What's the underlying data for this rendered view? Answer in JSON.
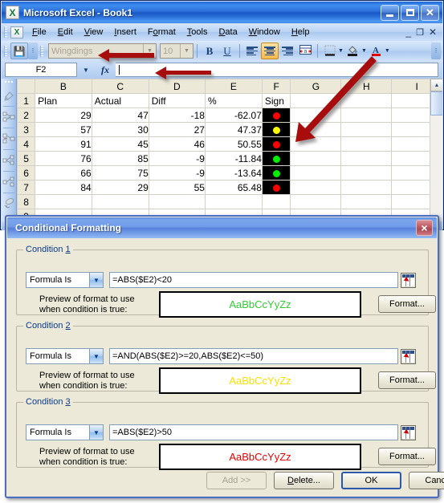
{
  "excel": {
    "title": "Microsoft Excel - Book1",
    "window_buttons": {
      "minimize": "minimize-icon",
      "restore": "restore-icon",
      "close": "close-icon"
    },
    "menus": [
      {
        "label": "File",
        "accel": "F"
      },
      {
        "label": "Edit",
        "accel": "E"
      },
      {
        "label": "View",
        "accel": "V"
      },
      {
        "label": "Insert",
        "accel": "I"
      },
      {
        "label": "Format",
        "accel": "o"
      },
      {
        "label": "Tools",
        "accel": "T"
      },
      {
        "label": "Data",
        "accel": "D"
      },
      {
        "label": "Window",
        "accel": "W"
      },
      {
        "label": "Help",
        "accel": "H"
      }
    ],
    "doc_buttons": {
      "minimize": "_",
      "restore": "restore-doc-icon",
      "close": "×"
    },
    "toolbar": {
      "font_name": "Wingdings",
      "font_size": "10",
      "bold": "B",
      "underline": "U",
      "align_left": "align-left-icon",
      "align_center": "align-center-icon",
      "align_right": "align-right-icon",
      "merge_center": "merge-and-center-icon",
      "borders": "borders-icon",
      "fill_color": "fill-color-icon",
      "font_color": "font-color-icon"
    },
    "formula_bar": {
      "name_box": "F2",
      "fx_label": "fx",
      "value": ""
    },
    "sheet": {
      "columns": [
        "B",
        "C",
        "D",
        "E",
        "F",
        "G",
        "H",
        "I"
      ],
      "rows": [
        "1",
        "2",
        "3",
        "4",
        "5",
        "6",
        "7",
        "8",
        "9"
      ],
      "data": [
        {
          "row": "1",
          "B": "Plan",
          "C": "Actual",
          "D": "Diff",
          "E": "%",
          "F": "Sign",
          "text_row": true
        },
        {
          "row": "2",
          "B": "29",
          "C": "47",
          "D": "-18",
          "E": "-62.07",
          "sign": "#ff0000"
        },
        {
          "row": "3",
          "B": "57",
          "C": "30",
          "D": "27",
          "E": "47.37",
          "sign": "#ffff00"
        },
        {
          "row": "4",
          "B": "91",
          "C": "45",
          "D": "46",
          "E": "50.55",
          "sign": "#ff0000"
        },
        {
          "row": "5",
          "B": "76",
          "C": "85",
          "D": "-9",
          "E": "-11.84",
          "sign": "#00ee00"
        },
        {
          "row": "6",
          "B": "66",
          "C": "75",
          "D": "-9",
          "E": "-13.64",
          "sign": "#00ee00"
        },
        {
          "row": "7",
          "B": "84",
          "C": "29",
          "D": "55",
          "E": "65.48",
          "sign": "#ff0000"
        },
        {
          "row": "8",
          "B": "",
          "C": "",
          "D": "",
          "E": "",
          "sign": ""
        },
        {
          "row": "9",
          "B": "",
          "C": "",
          "D": "",
          "E": "",
          "sign": ""
        }
      ]
    }
  },
  "dialog": {
    "title": "Conditional Formatting",
    "close_label": "×",
    "preview_label_line1": "Preview of format to use",
    "preview_label_line2": "when condition is true:",
    "preview_sample": "AaBbCcYyZz",
    "format_button": "Format...",
    "conditions": [
      {
        "legend": "Condition 1",
        "legend_num": "1",
        "type": "Formula Is",
        "formula": "=ABS($E2)<20",
        "preview_color": "#33cc33"
      },
      {
        "legend": "Condition 2",
        "legend_num": "2",
        "type": "Formula Is",
        "formula": "=AND(ABS($E2)>=20,ABS($E2)<=50)",
        "preview_color": "#ffe000"
      },
      {
        "legend": "Condition 3",
        "legend_num": "3",
        "type": "Formula Is",
        "formula": "=ABS($E2)>50",
        "preview_color": "#ee0000"
      }
    ],
    "buttons": {
      "add": "Add >>",
      "delete": "Delete...",
      "ok": "OK",
      "cancel": "Cancel"
    }
  },
  "annotations": {
    "arrow_color": "#a81010",
    "arrows": [
      {
        "name": "arrow-to-font-name-box"
      },
      {
        "name": "arrow-to-formula-bar"
      },
      {
        "name": "arrow-to-sign-column"
      }
    ]
  }
}
